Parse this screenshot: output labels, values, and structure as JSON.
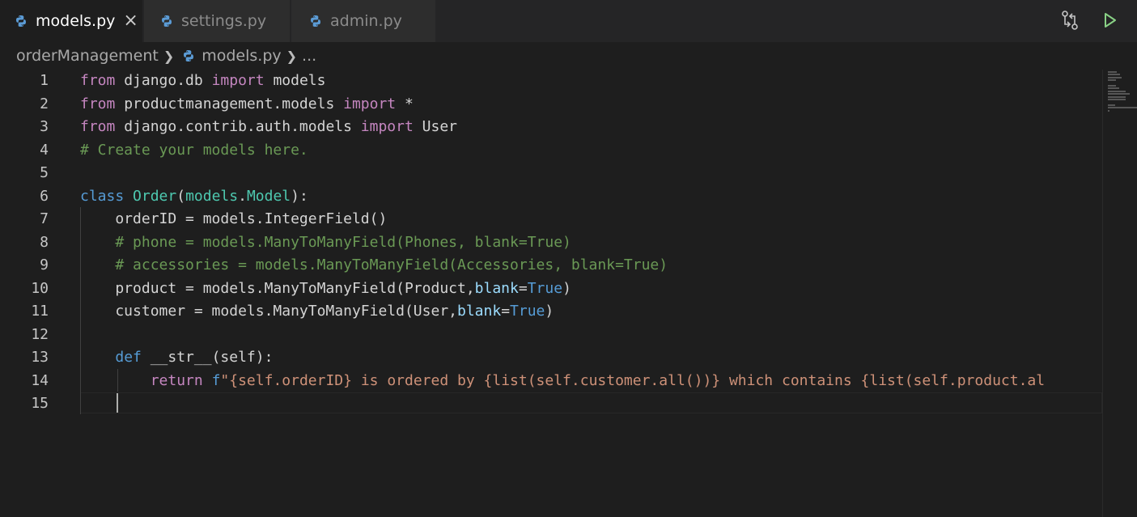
{
  "tabs": [
    {
      "label": "models.py",
      "active": true
    },
    {
      "label": "settings.py",
      "active": false
    },
    {
      "label": "admin.py",
      "active": false
    }
  ],
  "tab_close_glyph": "×",
  "icons": {
    "python": "python-file-icon",
    "compare": "git-compare-icon",
    "run": "run-play-icon"
  },
  "breadcrumb": {
    "folder": "orderManagement",
    "file": "models.py",
    "more": "..."
  },
  "editor": {
    "line_numbers": [
      "1",
      "2",
      "3",
      "4",
      "5",
      "6",
      "7",
      "8",
      "9",
      "10",
      "11",
      "12",
      "13",
      "14",
      "15"
    ],
    "lines": [
      [
        {
          "t": "from",
          "c": "kw"
        },
        {
          "t": " django.db ",
          "c": "pl"
        },
        {
          "t": "import",
          "c": "kw"
        },
        {
          "t": " models",
          "c": "pl"
        }
      ],
      [
        {
          "t": "from",
          "c": "kw"
        },
        {
          "t": " productmanagement.models ",
          "c": "pl"
        },
        {
          "t": "import",
          "c": "kw"
        },
        {
          "t": " *",
          "c": "pl"
        }
      ],
      [
        {
          "t": "from",
          "c": "kw"
        },
        {
          "t": " django.contrib.auth.models ",
          "c": "pl"
        },
        {
          "t": "import",
          "c": "kw"
        },
        {
          "t": " User",
          "c": "pl"
        }
      ],
      [
        {
          "t": "# Create your models here.",
          "c": "cm"
        }
      ],
      [],
      [
        {
          "t": "class",
          "c": "st"
        },
        {
          "t": " ",
          "c": "pl"
        },
        {
          "t": "Order",
          "c": "cls"
        },
        {
          "t": "(",
          "c": "pl"
        },
        {
          "t": "models",
          "c": "cls"
        },
        {
          "t": ".",
          "c": "pl"
        },
        {
          "t": "Model",
          "c": "cls"
        },
        {
          "t": "):",
          "c": "pl"
        }
      ],
      [
        {
          "t": "    orderID = models.IntegerField()",
          "c": "pl"
        }
      ],
      [
        {
          "t": "    ",
          "c": "pl"
        },
        {
          "t": "# phone = models.ManyToManyField(Phones, blank=True)",
          "c": "cm"
        }
      ],
      [
        {
          "t": "    ",
          "c": "pl"
        },
        {
          "t": "# accessories = models.ManyToManyField(Accessories, blank=True)",
          "c": "cm"
        }
      ],
      [
        {
          "t": "    product = models.ManyToManyField(Product,",
          "c": "pl"
        },
        {
          "t": "blank",
          "c": "param"
        },
        {
          "t": "=",
          "c": "pl"
        },
        {
          "t": "True",
          "c": "st"
        },
        {
          "t": ")",
          "c": "pl"
        }
      ],
      [
        {
          "t": "    customer = models.ManyToManyField(User,",
          "c": "pl"
        },
        {
          "t": "blank",
          "c": "param"
        },
        {
          "t": "=",
          "c": "pl"
        },
        {
          "t": "True",
          "c": "st"
        },
        {
          "t": ")",
          "c": "pl"
        }
      ],
      [],
      [
        {
          "t": "    ",
          "c": "pl"
        },
        {
          "t": "def",
          "c": "st"
        },
        {
          "t": " __str__(self):",
          "c": "pl"
        }
      ],
      [
        {
          "t": "        ",
          "c": "pl"
        },
        {
          "t": "return",
          "c": "kw"
        },
        {
          "t": " ",
          "c": "pl"
        },
        {
          "t": "f",
          "c": "st"
        },
        {
          "t": "\"{self.orderID} is ordered by {list(self.customer.all())} which contains {list(self.product.al",
          "c": "str"
        }
      ],
      [
        {
          "t": "    ",
          "c": "pl"
        }
      ]
    ]
  }
}
